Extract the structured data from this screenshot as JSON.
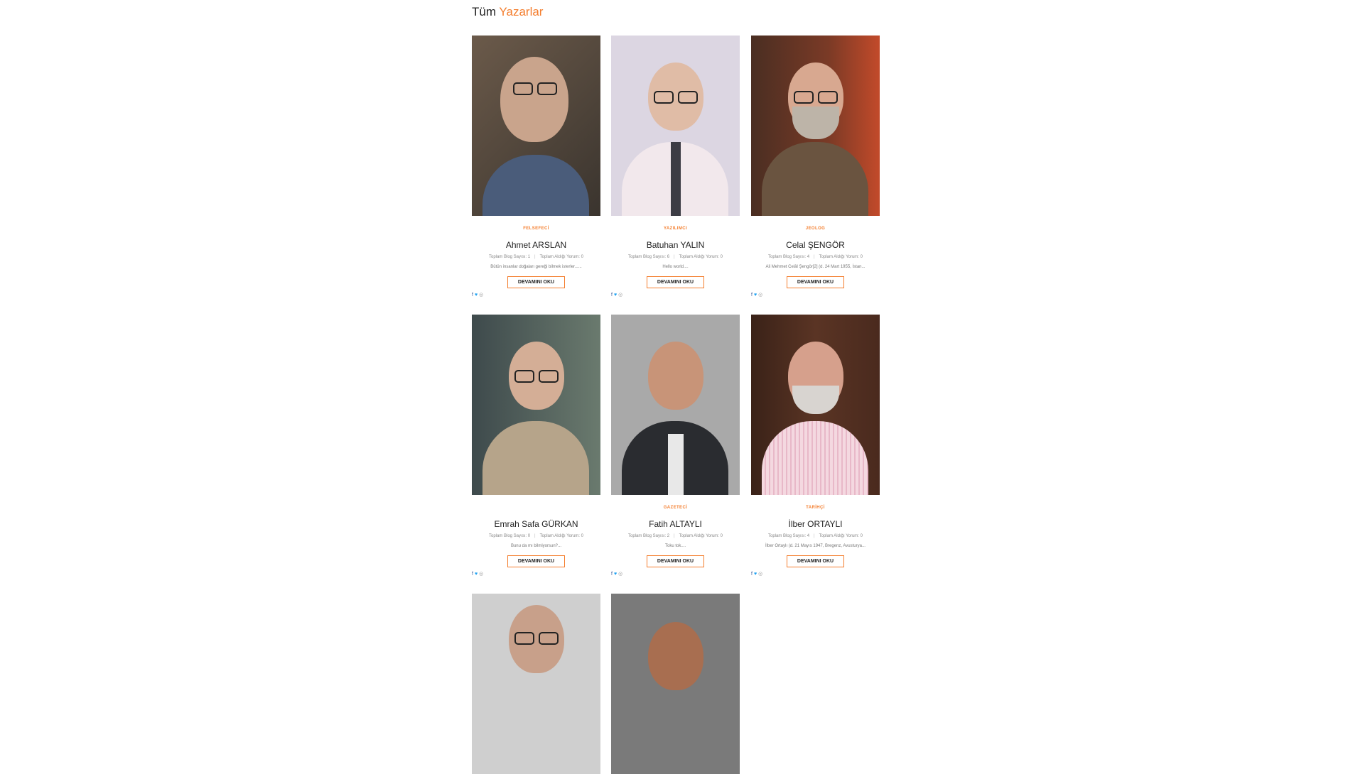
{
  "header": {
    "title_prefix": "Tüm",
    "title_accent": "Yazarlar"
  },
  "read_more_label": "DEVAMINI OKU",
  "stats_labels": {
    "blog": "Toplam Blog Sayısı:",
    "comments": "Toplam Aldığı Yorum:"
  },
  "authors": [
    {
      "category": "FELSEFECİ",
      "name": "Ahmet ARSLAN",
      "blog_count": "1",
      "comment_count": "0",
      "excerpt": "Bütün insanlar doğaları gereği bilmek isterler......"
    },
    {
      "category": "YAZILIMCI",
      "name": "Batuhan YALIN",
      "blog_count": "6",
      "comment_count": "0",
      "excerpt": "Hello world...."
    },
    {
      "category": "JEOLOG",
      "name": "Celal ŞENGÖR",
      "blog_count": "4",
      "comment_count": "0",
      "excerpt": "Ali Mehmet Celâl Şengör[2] (d. 24 Mart 1955, İstan..."
    },
    {
      "category": "",
      "name": "Emrah Safa GÜRKAN",
      "blog_count": "0",
      "comment_count": "0",
      "excerpt": "Bunu da mı bilmiyorsun?..."
    },
    {
      "category": "GAZETECİ",
      "name": "Fatih ALTAYLI",
      "blog_count": "2",
      "comment_count": "0",
      "excerpt": "Toku tok...."
    },
    {
      "category": "TARİHÇİ",
      "name": "İlber ORTAYLI",
      "blog_count": "4",
      "comment_count": "0",
      "excerpt": "İlber Ortaylı (d. 21 Mayıs 1947, Bregenz, Avusturya..."
    }
  ],
  "social_icons": [
    "facebook-icon",
    "twitter-icon",
    "instagram-icon"
  ]
}
